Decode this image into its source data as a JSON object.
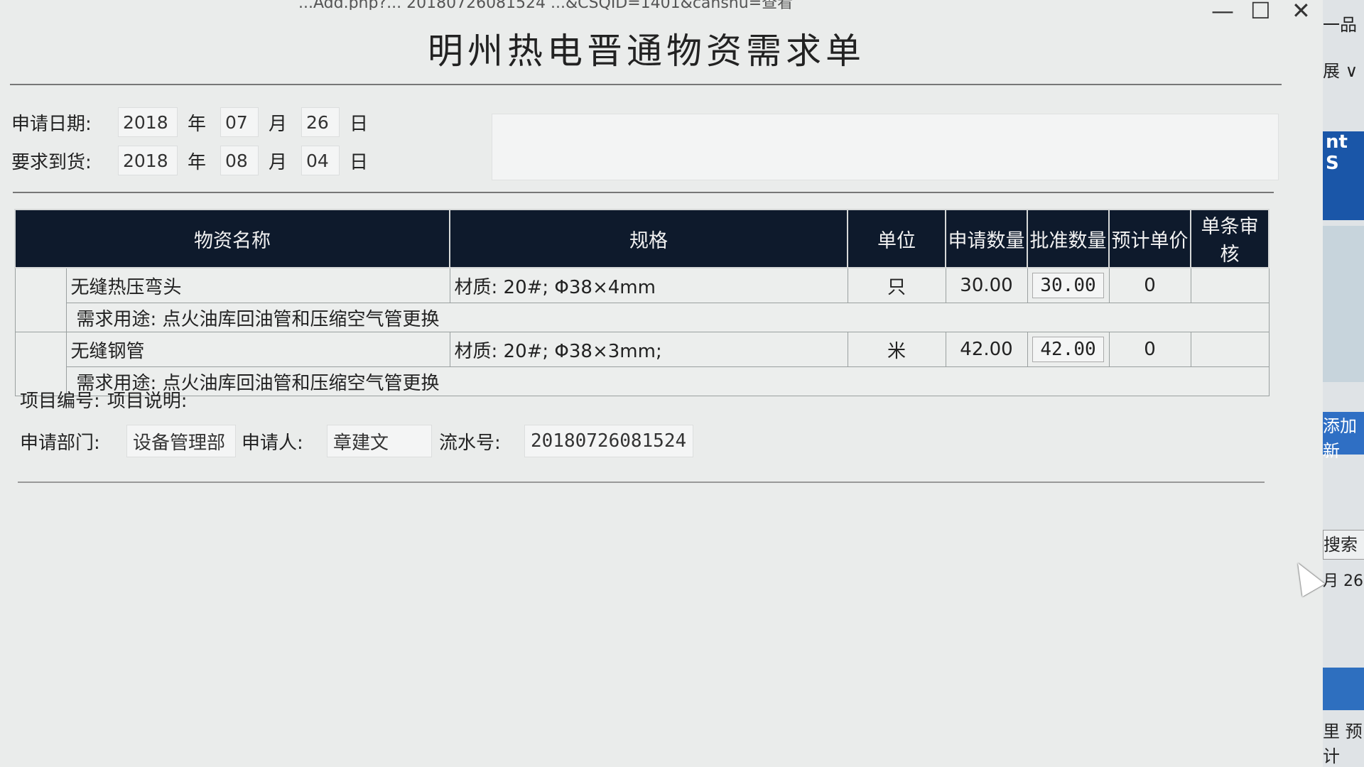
{
  "window": {
    "titlebar": "...Add.php?... 20180726081524 ...&CSQID=1401&canshu=查看",
    "controls": {
      "min": "—",
      "max": "☐",
      "close": "✕"
    }
  },
  "form": {
    "title": "明州热电晋通物资需求单",
    "apply_date": {
      "label": "申请日期:",
      "year": "2018",
      "month": "07",
      "day": "26"
    },
    "required_date": {
      "label": "要求到货:",
      "year": "2018",
      "month": "08",
      "day": "04"
    },
    "units": {
      "year": "年",
      "month": "月",
      "day": "日"
    }
  },
  "table": {
    "headers": [
      "物资名称",
      "规格",
      "单位",
      "申请数量",
      "批准数量",
      "预计单价",
      "单条审核"
    ],
    "rows": [
      {
        "name": "无缝热压弯头",
        "spec": "材质: 20#; Φ38×4mm",
        "unit": "只",
        "apply_qty": "30.00",
        "approved_qty": "30.00",
        "est_price": "0",
        "review": "",
        "purpose": "需求用途: 点火油库回油管和压缩空气管更换"
      },
      {
        "name": "无缝钢管",
        "spec": "材质: 20#; Φ38×3mm;",
        "unit": "米",
        "apply_qty": "42.00",
        "approved_qty": "42.00",
        "est_price": "0",
        "review": "",
        "purpose": "需求用途: 点火油库回油管和压缩空气管更换"
      }
    ]
  },
  "footer": {
    "project_no_label": "项目编号:",
    "project_desc_label": "项目说明:",
    "dept_label": "申请部门:",
    "dept_value": "设备管理部",
    "applicant_label": "申请人:",
    "applicant_value": "章建文",
    "serial_label": "流水号:",
    "serial_value": "20180726081524"
  },
  "background_window": {
    "top": "一品",
    "expand": "展 ∨",
    "banner": "nt S",
    "add_button": "添加新",
    "search_button": "搜索",
    "date_fragment": "月 26",
    "footer_labels": "里  预计"
  }
}
